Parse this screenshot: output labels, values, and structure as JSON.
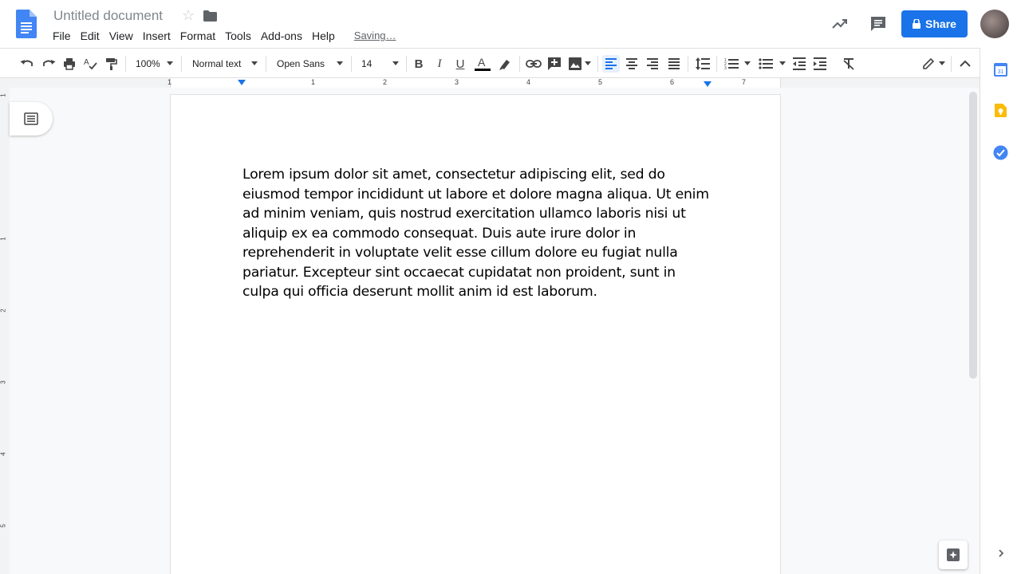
{
  "document": {
    "title": "Untitled document",
    "saving_status": "Saving…",
    "body": "Lorem ipsum dolor sit amet, consectetur adipiscing elit, sed do eiusmod tempor incididunt ut labore et dolore magna aliqua. Ut enim ad minim veniam, quis nostrud exercitation ullamco laboris nisi ut aliquip ex ea commodo consequat. Duis aute irure dolor in reprehenderit in voluptate velit esse cillum dolore eu fugiat nulla pariatur. Excepteur sint occaecat cupidatat non proident, sunt in culpa qui officia deserunt mollit anim id est laborum."
  },
  "menu": {
    "items": [
      "File",
      "Edit",
      "View",
      "Insert",
      "Format",
      "Tools",
      "Add-ons",
      "Help"
    ]
  },
  "header": {
    "share_label": "Share"
  },
  "toolbar": {
    "zoom": "100%",
    "style": "Normal text",
    "font": "Open Sans",
    "font_size": "14"
  },
  "ruler": {
    "labels": [
      "1",
      "1",
      "2",
      "3",
      "4",
      "5",
      "6",
      "7"
    ]
  },
  "vertical_ruler": {
    "labels": [
      "1",
      "1",
      "2",
      "3",
      "4",
      "5"
    ]
  },
  "sidepanel": {
    "calendar_day": "31"
  },
  "colors": {
    "accent": "#1a73e8",
    "keep": "#fbbc04",
    "tasks": "#4285f4"
  },
  "icons": [
    "docs-logo-icon",
    "star-icon",
    "folder-icon",
    "activity-trend-icon",
    "comment-icon",
    "lock-icon",
    "undo-icon",
    "redo-icon",
    "print-icon",
    "spellcheck-icon",
    "paint-format-icon",
    "bold-icon",
    "italic-icon",
    "underline-icon",
    "text-color-icon",
    "highlight-icon",
    "link-icon",
    "insert-comment-icon",
    "image-icon",
    "align-left-icon",
    "align-center-icon",
    "align-right-icon",
    "justify-icon",
    "line-spacing-icon",
    "numbered-list-icon",
    "bulleted-list-icon",
    "decrease-indent-icon",
    "increase-indent-icon",
    "clear-formatting-icon",
    "editing-mode-icon",
    "collapse-icon",
    "outline-icon",
    "calendar-icon",
    "keep-icon",
    "tasks-icon",
    "explore-icon"
  ]
}
